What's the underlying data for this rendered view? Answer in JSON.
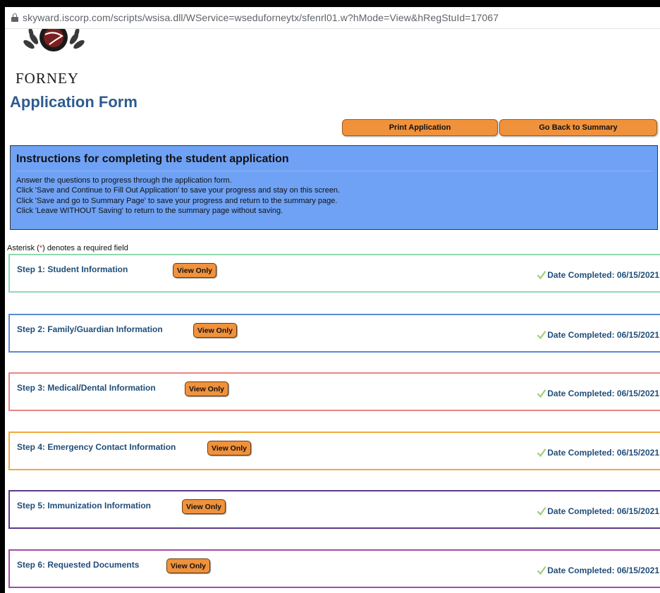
{
  "browser": {
    "url": "skyward.iscorp.com/scripts/wsisa.dll/WService=wseduforneytx/sfenrl01.w?hMode=View&hRegStuId=17067"
  },
  "logo": {
    "text": "FORNEY"
  },
  "page": {
    "title": "Application Form"
  },
  "actions": {
    "print_label": "Print Application",
    "back_label": "Go Back to Summary"
  },
  "instructions": {
    "heading": "Instructions for completing the student application",
    "lines": [
      "Answer the questions to progress through the application form.",
      "Click 'Save and Continue to Fill Out Application' to save your progress and stay on this screen.",
      "Click 'Save and go to Summary Page' to save your progress and return to the summary page.",
      "Click 'Leave WITHOUT Saving' to return to the summary page without saving."
    ]
  },
  "required_note": {
    "prefix": "Asterisk (",
    "star": "*",
    "suffix": ") denotes a required field"
  },
  "steps": [
    {
      "title": "Step 1: Student Information",
      "button": "View Only",
      "completed": "Date Completed: 06/15/2021",
      "color": "#8fd9b0"
    },
    {
      "title": "Step 2: Family/Guardian Information",
      "button": "View Only",
      "completed": "Date Completed: 06/15/2021",
      "color": "#5b8ad6"
    },
    {
      "title": "Step 3: Medical/Dental Information",
      "button": "View Only",
      "completed": "Date Completed: 06/15/2021",
      "color": "#e98585"
    },
    {
      "title": "Step 4: Emergency Contact Information",
      "button": "View Only",
      "completed": "Date Completed: 06/15/2021",
      "color": "#f2a93b"
    },
    {
      "title": "Step 5: Immunization Information",
      "button": "View Only",
      "completed": "Date Completed: 06/15/2021",
      "color": "#5a3a86"
    },
    {
      "title": "Step 6: Requested Documents",
      "button": "View Only",
      "completed": "Date Completed: 06/15/2021",
      "color": "#a54aa8"
    }
  ],
  "colors": {
    "title_blue": "#2e5b8f",
    "button_orange": "#f0923c",
    "instructions_bg": "#6fa2f5",
    "check_green": "#9ccf7a"
  },
  "icons": {
    "lock": "lock-icon",
    "check": "check-icon"
  }
}
